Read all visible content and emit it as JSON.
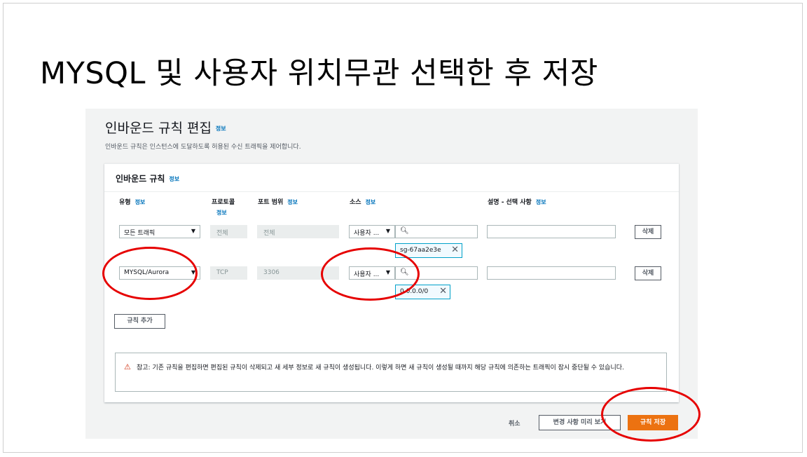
{
  "slide": {
    "title": "MYSQL 및 사용자 위치무관 선택한 후 저장"
  },
  "page": {
    "heading": "인바운드 규칙 편집",
    "heading_info": "정보",
    "description": "인바운드 규칙은 인스턴스에 도달하도록 허용된 수신 트래픽을 제어합니다."
  },
  "panel": {
    "title": "인바운드 규칙",
    "title_info": "정보",
    "columns": {
      "type": "유형",
      "type_info": "정보",
      "protocol": "프로토콜",
      "protocol_info": "정보",
      "port": "포트 범위",
      "port_info": "정보",
      "source": "소스",
      "source_info": "정보",
      "description": "설명 - 선택 사항",
      "description_info": "정보"
    },
    "rows": [
      {
        "type": "모든 트래픽",
        "protocol": "전체",
        "port": "전체",
        "source": "사용자 ...",
        "search": "",
        "token": "sg-67aa2e3e",
        "desc": "",
        "delete": "삭제"
      },
      {
        "type": "MYSQL/Aurora",
        "protocol": "TCP",
        "port": "3306",
        "source": "사용자 ...",
        "search": "",
        "token": "0.0.0.0/0",
        "desc": "",
        "delete": "삭제"
      }
    ],
    "add_rule": "규칙 추가",
    "alert": "참고: 기존 규칙을 편집하면 편집된 규칙이 삭제되고 새 세부 정보로 새 규칙이 생성됩니다. 이렇게 하면 새 규칙이 생성될 때까지 해당 규칙에 의존하는 트래픽이 잠시 중단될 수 있습니다."
  },
  "footer": {
    "cancel": "취소",
    "preview": "변경 사항 미리 보기",
    "save": "규칙 저장"
  },
  "icons": {
    "dropdown": "caret-down-icon",
    "search": "search-icon",
    "remove": "close-icon",
    "warning": "warning-icon"
  },
  "colors": {
    "primary_button": "#ec7211",
    "link": "#0073bb",
    "annotation": "#e60000"
  }
}
